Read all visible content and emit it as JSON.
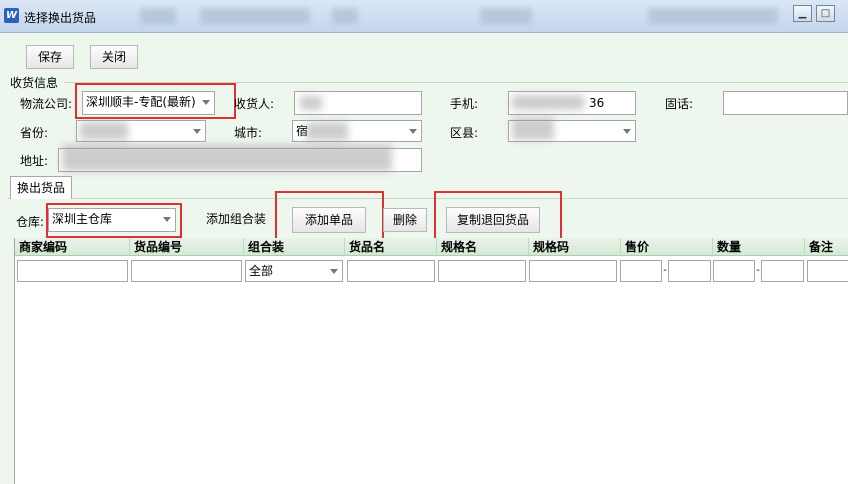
{
  "window": {
    "title": "选择换出货品",
    "minimize_label": "▁",
    "maximize_label": "□"
  },
  "toolbar": {
    "save_label": "保存",
    "close_label": "关闭"
  },
  "receiver_section": {
    "title": "收货信息",
    "logistics_label": "物流公司:",
    "logistics_value": "深圳顺丰-专配(最新)",
    "receiver_label": "收货人:",
    "receiver_value": "",
    "mobile_label": "手机:",
    "mobile_suffix": "36",
    "landline_label": "固话:",
    "landline_value": "",
    "province_label": "省份:",
    "province_value": "",
    "city_label": "城市:",
    "city_value": "宿",
    "district_label": "区县:",
    "district_value": "",
    "address_label": "地址:",
    "address_value": ""
  },
  "tab": {
    "label": "换出货品"
  },
  "goods_toolbar": {
    "warehouse_label": "仓库:",
    "warehouse_value": "深圳主仓库",
    "add_combo_label": "添加组合装",
    "add_single_label": "添加单品",
    "delete_label": "删除",
    "copy_return_label": "复制退回货品"
  },
  "grid": {
    "columns": [
      "商家编码",
      "货品编号",
      "组合装",
      "货品名",
      "规格名",
      "规格码",
      "售价",
      "数量",
      "备注"
    ],
    "combo_filter_value": "全部",
    "range_sep": "-"
  },
  "colors": {
    "highlight": "#e03030",
    "panel_bg": "#eef7ee",
    "header_bg": "#d3e9d3"
  }
}
